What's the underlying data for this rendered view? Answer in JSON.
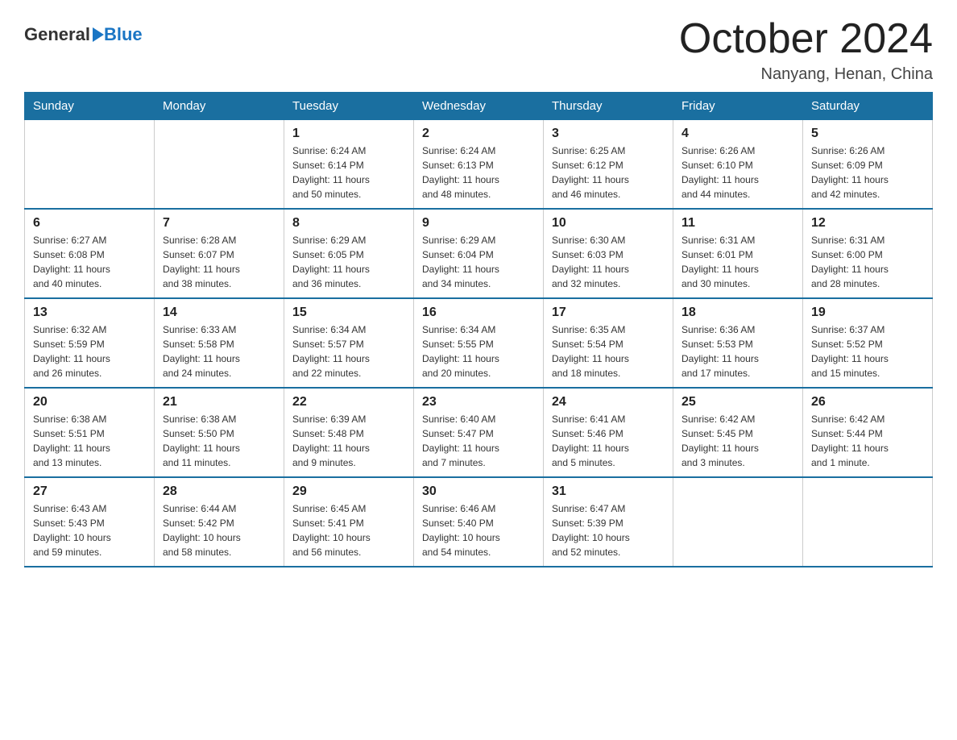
{
  "header": {
    "logo_general": "General",
    "logo_blue": "Blue",
    "month_title": "October 2024",
    "location": "Nanyang, Henan, China"
  },
  "columns": [
    "Sunday",
    "Monday",
    "Tuesday",
    "Wednesday",
    "Thursday",
    "Friday",
    "Saturday"
  ],
  "weeks": [
    [
      {
        "day": "",
        "info": ""
      },
      {
        "day": "",
        "info": ""
      },
      {
        "day": "1",
        "info": "Sunrise: 6:24 AM\nSunset: 6:14 PM\nDaylight: 11 hours\nand 50 minutes."
      },
      {
        "day": "2",
        "info": "Sunrise: 6:24 AM\nSunset: 6:13 PM\nDaylight: 11 hours\nand 48 minutes."
      },
      {
        "day": "3",
        "info": "Sunrise: 6:25 AM\nSunset: 6:12 PM\nDaylight: 11 hours\nand 46 minutes."
      },
      {
        "day": "4",
        "info": "Sunrise: 6:26 AM\nSunset: 6:10 PM\nDaylight: 11 hours\nand 44 minutes."
      },
      {
        "day": "5",
        "info": "Sunrise: 6:26 AM\nSunset: 6:09 PM\nDaylight: 11 hours\nand 42 minutes."
      }
    ],
    [
      {
        "day": "6",
        "info": "Sunrise: 6:27 AM\nSunset: 6:08 PM\nDaylight: 11 hours\nand 40 minutes."
      },
      {
        "day": "7",
        "info": "Sunrise: 6:28 AM\nSunset: 6:07 PM\nDaylight: 11 hours\nand 38 minutes."
      },
      {
        "day": "8",
        "info": "Sunrise: 6:29 AM\nSunset: 6:05 PM\nDaylight: 11 hours\nand 36 minutes."
      },
      {
        "day": "9",
        "info": "Sunrise: 6:29 AM\nSunset: 6:04 PM\nDaylight: 11 hours\nand 34 minutes."
      },
      {
        "day": "10",
        "info": "Sunrise: 6:30 AM\nSunset: 6:03 PM\nDaylight: 11 hours\nand 32 minutes."
      },
      {
        "day": "11",
        "info": "Sunrise: 6:31 AM\nSunset: 6:01 PM\nDaylight: 11 hours\nand 30 minutes."
      },
      {
        "day": "12",
        "info": "Sunrise: 6:31 AM\nSunset: 6:00 PM\nDaylight: 11 hours\nand 28 minutes."
      }
    ],
    [
      {
        "day": "13",
        "info": "Sunrise: 6:32 AM\nSunset: 5:59 PM\nDaylight: 11 hours\nand 26 minutes."
      },
      {
        "day": "14",
        "info": "Sunrise: 6:33 AM\nSunset: 5:58 PM\nDaylight: 11 hours\nand 24 minutes."
      },
      {
        "day": "15",
        "info": "Sunrise: 6:34 AM\nSunset: 5:57 PM\nDaylight: 11 hours\nand 22 minutes."
      },
      {
        "day": "16",
        "info": "Sunrise: 6:34 AM\nSunset: 5:55 PM\nDaylight: 11 hours\nand 20 minutes."
      },
      {
        "day": "17",
        "info": "Sunrise: 6:35 AM\nSunset: 5:54 PM\nDaylight: 11 hours\nand 18 minutes."
      },
      {
        "day": "18",
        "info": "Sunrise: 6:36 AM\nSunset: 5:53 PM\nDaylight: 11 hours\nand 17 minutes."
      },
      {
        "day": "19",
        "info": "Sunrise: 6:37 AM\nSunset: 5:52 PM\nDaylight: 11 hours\nand 15 minutes."
      }
    ],
    [
      {
        "day": "20",
        "info": "Sunrise: 6:38 AM\nSunset: 5:51 PM\nDaylight: 11 hours\nand 13 minutes."
      },
      {
        "day": "21",
        "info": "Sunrise: 6:38 AM\nSunset: 5:50 PM\nDaylight: 11 hours\nand 11 minutes."
      },
      {
        "day": "22",
        "info": "Sunrise: 6:39 AM\nSunset: 5:48 PM\nDaylight: 11 hours\nand 9 minutes."
      },
      {
        "day": "23",
        "info": "Sunrise: 6:40 AM\nSunset: 5:47 PM\nDaylight: 11 hours\nand 7 minutes."
      },
      {
        "day": "24",
        "info": "Sunrise: 6:41 AM\nSunset: 5:46 PM\nDaylight: 11 hours\nand 5 minutes."
      },
      {
        "day": "25",
        "info": "Sunrise: 6:42 AM\nSunset: 5:45 PM\nDaylight: 11 hours\nand 3 minutes."
      },
      {
        "day": "26",
        "info": "Sunrise: 6:42 AM\nSunset: 5:44 PM\nDaylight: 11 hours\nand 1 minute."
      }
    ],
    [
      {
        "day": "27",
        "info": "Sunrise: 6:43 AM\nSunset: 5:43 PM\nDaylight: 10 hours\nand 59 minutes."
      },
      {
        "day": "28",
        "info": "Sunrise: 6:44 AM\nSunset: 5:42 PM\nDaylight: 10 hours\nand 58 minutes."
      },
      {
        "day": "29",
        "info": "Sunrise: 6:45 AM\nSunset: 5:41 PM\nDaylight: 10 hours\nand 56 minutes."
      },
      {
        "day": "30",
        "info": "Sunrise: 6:46 AM\nSunset: 5:40 PM\nDaylight: 10 hours\nand 54 minutes."
      },
      {
        "day": "31",
        "info": "Sunrise: 6:47 AM\nSunset: 5:39 PM\nDaylight: 10 hours\nand 52 minutes."
      },
      {
        "day": "",
        "info": ""
      },
      {
        "day": "",
        "info": ""
      }
    ]
  ]
}
